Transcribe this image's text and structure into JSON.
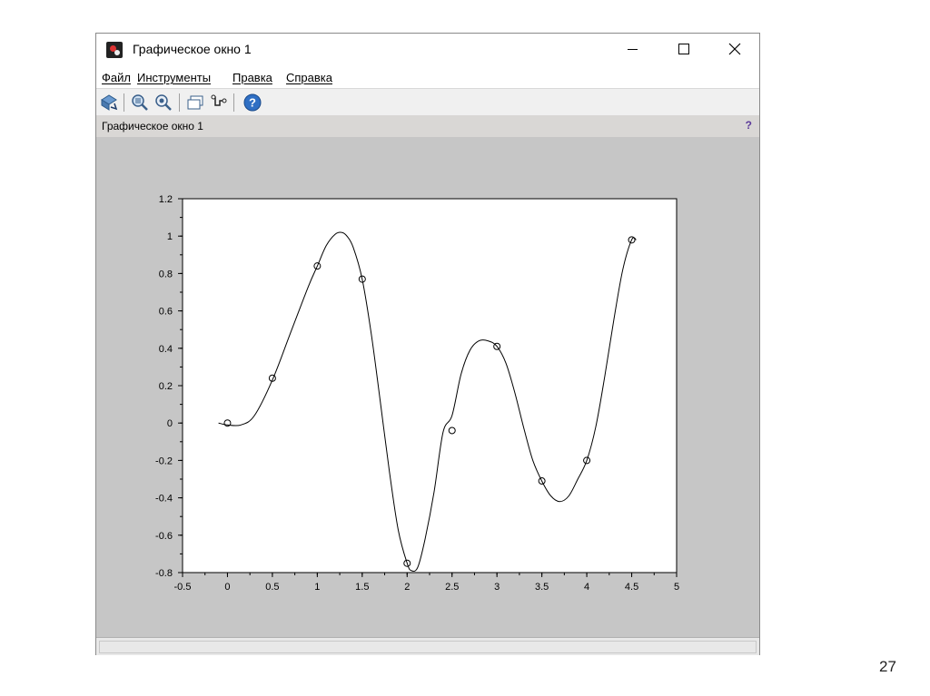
{
  "window": {
    "title": "Графическое окно 1",
    "figure_label": "Графическое окно 1",
    "help_mark": "?"
  },
  "menu": [
    {
      "label": "Файл"
    },
    {
      "label": "Инструменты"
    },
    {
      "label": "Правка"
    },
    {
      "label": "Справка"
    }
  ],
  "toolbar": {
    "icons": [
      "rotate-icon",
      "zoom-icon",
      "zoom-reset-icon",
      "window-icon",
      "datatip-icon",
      "help-icon"
    ]
  },
  "slide_number": "27",
  "chart_data": {
    "type": "line",
    "title": "",
    "xlabel": "",
    "ylabel": "",
    "xlim": [
      -0.5,
      5
    ],
    "ylim": [
      -0.8,
      1.2
    ],
    "xticks": [
      "-0.5",
      "0",
      "0.5",
      "1",
      "1.5",
      "2",
      "2.5",
      "3",
      "3.5",
      "4",
      "4.5",
      "5"
    ],
    "yticks": [
      "1.2",
      "1",
      "0.8",
      "0.6",
      "0.4",
      "0.2",
      "0",
      "-0.2",
      "-0.4",
      "-0.6",
      "-0.8"
    ],
    "grid": false,
    "series": [
      {
        "style": "line",
        "x": [
          -0.1,
          0,
          0.15,
          0.3,
          0.5,
          0.7,
          0.9,
          1.0,
          1.1,
          1.2,
          1.27,
          1.33,
          1.4,
          1.5,
          1.6,
          1.7,
          1.8,
          1.9,
          2.0,
          2.05,
          2.12,
          2.2,
          2.3,
          2.4,
          2.5,
          2.6,
          2.7,
          2.8,
          2.9,
          3.0,
          3.1,
          3.2,
          3.3,
          3.4,
          3.5,
          3.6,
          3.7,
          3.8,
          3.9,
          4.0,
          4.1,
          4.2,
          4.3,
          4.4,
          4.5,
          4.55
        ],
        "y": [
          0.0,
          -0.01,
          -0.01,
          0.04,
          0.23,
          0.48,
          0.73,
          0.84,
          0.95,
          1.01,
          1.02,
          1.0,
          0.94,
          0.77,
          0.48,
          0.12,
          -0.25,
          -0.57,
          -0.75,
          -0.79,
          -0.77,
          -0.62,
          -0.37,
          -0.05,
          0.04,
          0.26,
          0.39,
          0.44,
          0.44,
          0.41,
          0.32,
          0.16,
          -0.03,
          -0.2,
          -0.31,
          -0.39,
          -0.42,
          -0.39,
          -0.3,
          -0.2,
          -0.02,
          0.25,
          0.55,
          0.82,
          0.98,
          0.98
        ]
      },
      {
        "style": "markers",
        "marker": "circle",
        "x": [
          0,
          0.5,
          1.0,
          1.5,
          2.0,
          2.5,
          3.0,
          3.5,
          4.0,
          4.5
        ],
        "y": [
          0.0,
          0.24,
          0.84,
          0.77,
          -0.75,
          -0.04,
          0.41,
          -0.31,
          -0.2,
          0.98
        ]
      }
    ]
  }
}
